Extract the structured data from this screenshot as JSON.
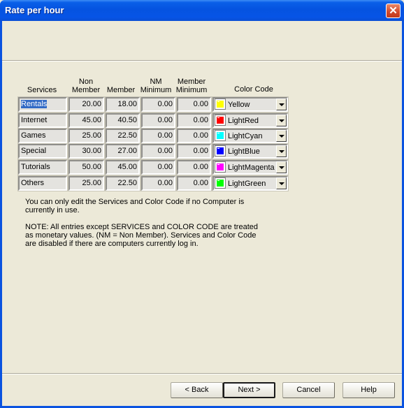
{
  "window": {
    "title": "Rate per hour",
    "close_label": "✕"
  },
  "table": {
    "headers": {
      "services": "Services",
      "non_member": [
        "Non",
        "Member"
      ],
      "member": "Member",
      "nm_minimum": [
        "NM",
        "Minimum"
      ],
      "member_minimum": [
        "Member",
        "Minimum"
      ],
      "color_code": "Color Code"
    },
    "rows": [
      {
        "service": "Rentals",
        "non_member": "20.00",
        "member": "18.00",
        "nm_minimum": "0.00",
        "member_minimum": "0.00",
        "color_label": "Yellow",
        "color_hex": "#ffff00"
      },
      {
        "service": "Internet",
        "non_member": "45.00",
        "member": "40.50",
        "nm_minimum": "0.00",
        "member_minimum": "0.00",
        "color_label": "LightRed",
        "color_hex": "#ff0000"
      },
      {
        "service": "Games",
        "non_member": "25.00",
        "member": "22.50",
        "nm_minimum": "0.00",
        "member_minimum": "0.00",
        "color_label": "LightCyan",
        "color_hex": "#00ffff"
      },
      {
        "service": "Special",
        "non_member": "30.00",
        "member": "27.00",
        "nm_minimum": "0.00",
        "member_minimum": "0.00",
        "color_label": "LightBlue",
        "color_hex": "#0000ff"
      },
      {
        "service": "Tutorials",
        "non_member": "50.00",
        "member": "45.00",
        "nm_minimum": "0.00",
        "member_minimum": "0.00",
        "color_label": "LightMagenta",
        "color_hex": "#ff00ff"
      },
      {
        "service": "Others",
        "non_member": "25.00",
        "member": "22.50",
        "nm_minimum": "0.00",
        "member_minimum": "0.00",
        "color_label": "LightGreen",
        "color_hex": "#00ff00"
      }
    ]
  },
  "notes": {
    "line1a": "You can only edit the Services and Color Code if no Computer is",
    "line1b": "currently in use.",
    "line2a": "NOTE: All entries except SERVICES and COLOR CODE are treated",
    "line2b": "as monetary values. (NM = Non Member). Services and Color Code",
    "line2c": "are disabled if there are computers currently log in."
  },
  "buttons": {
    "back": "< Back",
    "next": "Next >",
    "cancel": "Cancel",
    "help": "Help"
  }
}
